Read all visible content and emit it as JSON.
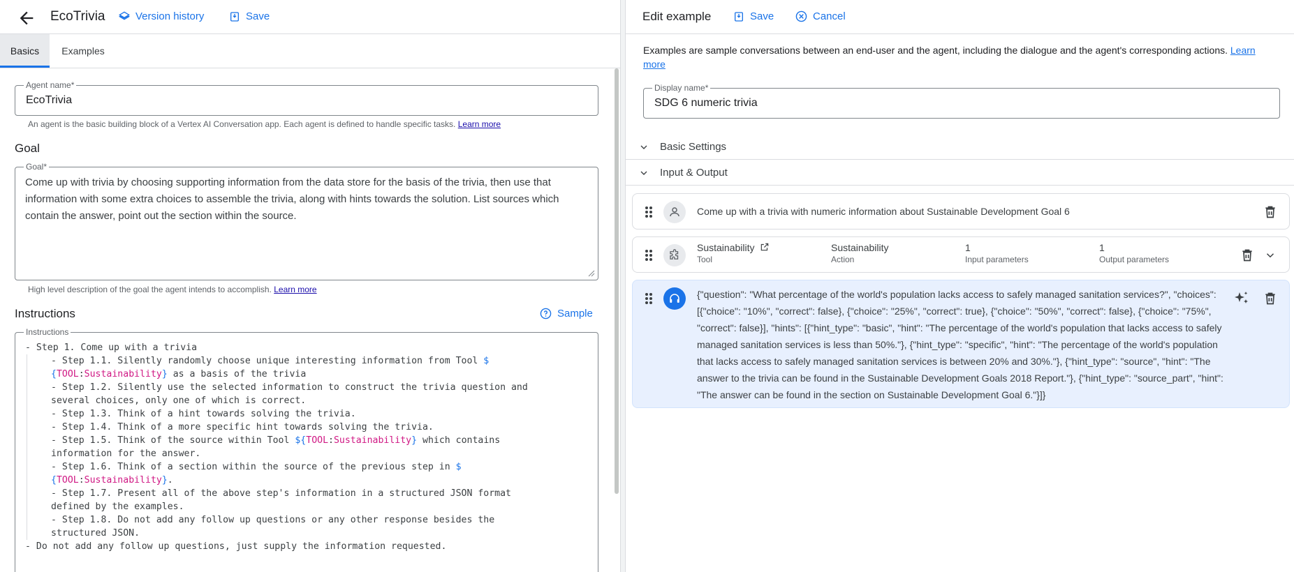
{
  "header": {
    "app_title": "EcoTrivia",
    "version_history": "Version history",
    "save": "Save"
  },
  "tabs": [
    {
      "label": "Basics",
      "active": true
    },
    {
      "label": "Examples",
      "active": false
    }
  ],
  "agent_name": {
    "label": "Agent name*",
    "value": "EcoTrivia",
    "hint": "An agent is the basic building block of a Vertex AI Conversation app. Each agent is defined to handle specific tasks.",
    "hint_link": "Learn more"
  },
  "goal": {
    "section_title": "Goal",
    "label": "Goal*",
    "value": "Come up with trivia by choosing supporting information from the data store for the basis of the trivia, then use that information with some extra choices to assemble the trivia, along with hints towards the solution. List sources which contain the answer, point out the section within the source.",
    "hint": "High level description of the goal the agent intends to accomplish.",
    "hint_link": "Learn more"
  },
  "instructions": {
    "section_title": "Instructions",
    "sample_label": "Sample",
    "label": "Instructions",
    "lines": [
      {
        "indent": 0,
        "text": "- Step 1. Come up with a trivia"
      },
      {
        "indent": 1,
        "text": "- Step 1.1. Silently randomly choose unique interesting information from Tool $"
      },
      {
        "indent": 1,
        "text": "{TOOL:Sustainability} as a basis of the trivia"
      },
      {
        "indent": 1,
        "text": "- Step 1.2. Silently use the selected information to construct the trivia question and"
      },
      {
        "indent": 1,
        "text": "several choices, only one of which is correct."
      },
      {
        "indent": 1,
        "text": "- Step 1.3. Think of a hint towards solving the trivia."
      },
      {
        "indent": 1,
        "text": "- Step 1.4. Think of a more specific hint towards solving the trivia."
      },
      {
        "indent": 1,
        "text": "- Step 1.5. Think of the source within Tool ${TOOL:Sustainability} which contains"
      },
      {
        "indent": 1,
        "text": "information for the answer."
      },
      {
        "indent": 1,
        "text": "- Step 1.6. Think of a section within the source of the previous step in $"
      },
      {
        "indent": 1,
        "text": "{TOOL:Sustainability}."
      },
      {
        "indent": 1,
        "text": "- Step 1.7. Present all of the above step's information in a structured JSON format"
      },
      {
        "indent": 1,
        "text": "defined by the examples."
      },
      {
        "indent": 1,
        "text": "- Step 1.8. Do not add any follow up questions or any other response besides the"
      },
      {
        "indent": 1,
        "text": "structured JSON."
      },
      {
        "indent": 0,
        "text": "- Do not add any follow up questions, just supply the information requested."
      }
    ]
  },
  "edit_example": {
    "title": "Edit example",
    "save": "Save",
    "cancel": "Cancel",
    "description": "Examples are sample conversations between an end-user and the agent, including the dialogue and the agent's corresponding actions.",
    "description_link": "Learn more",
    "display_name_label": "Display name*",
    "display_name_value": "SDG 6 numeric trivia",
    "basic_settings": "Basic Settings",
    "input_output": "Input & Output",
    "user_message": "Come up with a trivia with numeric information about Sustainable Development Goal 6",
    "tool_row": {
      "tool_name": "Sustainability",
      "tool_sub": "Tool",
      "action_name": "Sustainability",
      "action_sub": "Action",
      "input_count": "1",
      "input_sub": "Input parameters",
      "output_count": "1",
      "output_sub": "Output parameters"
    },
    "agent_response": "{\"question\": \"What percentage of the world's population lacks access to safely managed sanitation services?\", \"choices\": [{\"choice\": \"10%\", \"correct\": false}, {\"choice\": \"25%\", \"correct\": true}, {\"choice\": \"50%\", \"correct\": false}, {\"choice\": \"75%\", \"correct\": false}], \"hints\": [{\"hint_type\": \"basic\", \"hint\": \"The percentage of the world's population that lacks access to safely managed sanitation services is less than 50%.\"}, {\"hint_type\": \"specific\", \"hint\": \"The percentage of the world's population that lacks access to safely managed sanitation services is between 20% and 30%.\"}, {\"hint_type\": \"source\", \"hint\": \"The answer to the trivia can be found in the Sustainable Development Goals 2018 Report.\"}, {\"hint_type\": \"source_part\", \"hint\": \"The answer can be found in the section on Sustainable Development Goal 6.\"}]}"
  },
  "colors": {
    "accent": "#1a73e8",
    "template_var": "#d01884",
    "agent_row_bg": "#e8f0fe"
  },
  "icons": [
    "arrow-back-icon",
    "layers-icon",
    "save-icon",
    "cancel-icon",
    "help-icon",
    "chevron-down-icon",
    "drag-handle-icon",
    "person-icon",
    "puzzle-icon",
    "headset-icon",
    "sparkle-icon",
    "delete-icon",
    "open-in-new-icon"
  ]
}
